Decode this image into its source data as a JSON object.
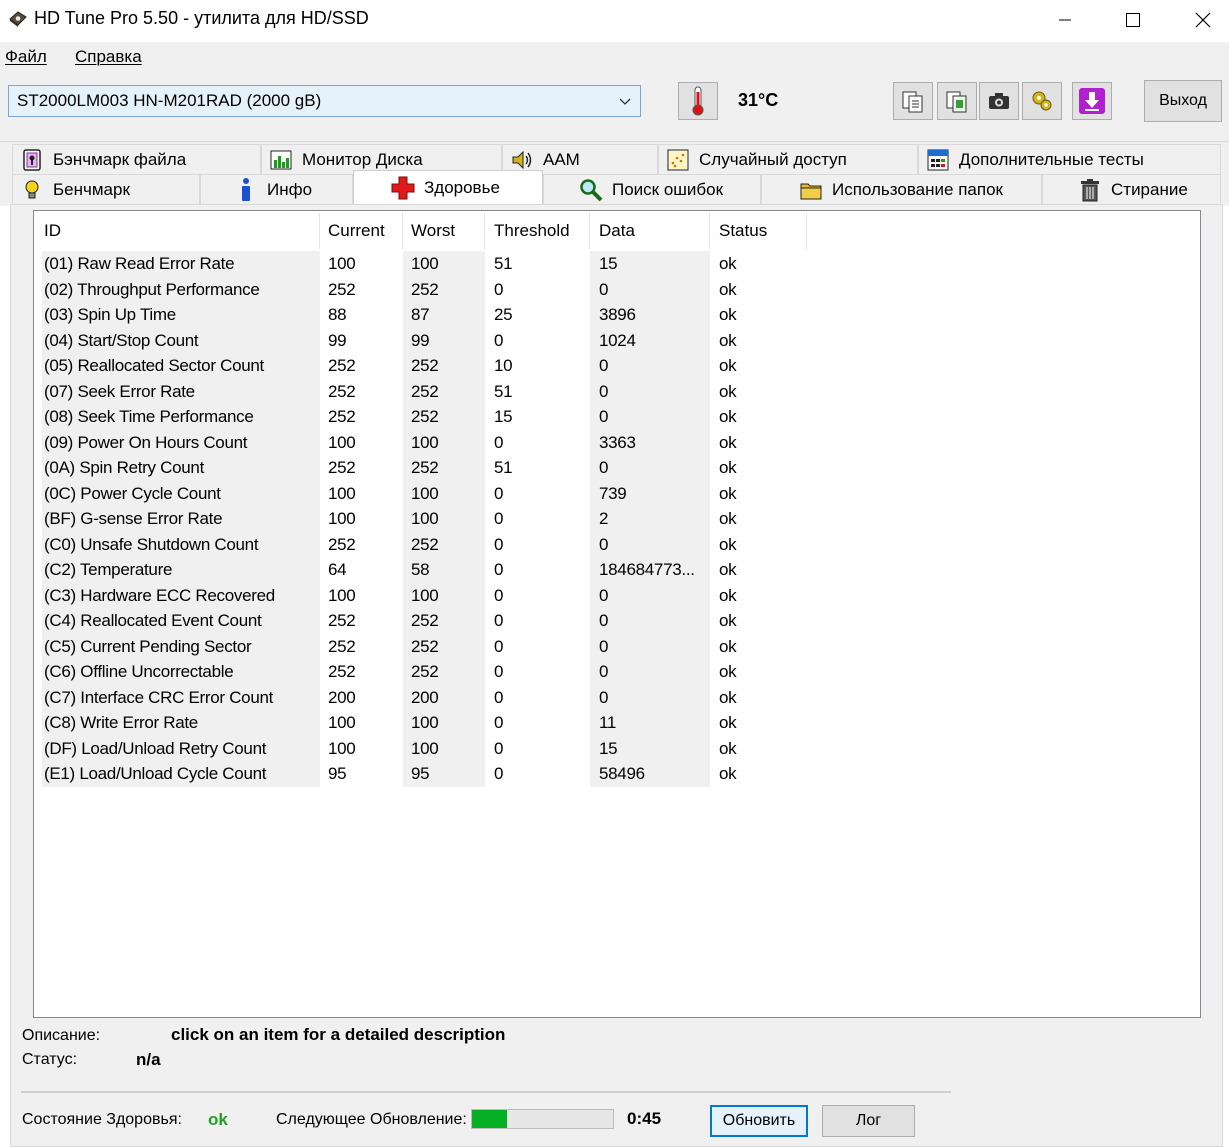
{
  "window": {
    "title": "HD Tune Pro 5.50 - утилита для HD/SSD"
  },
  "menu": {
    "file": "Файл",
    "help": "Справка"
  },
  "toolbar": {
    "drive": "ST2000LM003 HN-M201RAD (2000 gB)",
    "temperature": "31°C",
    "exit_label": "Выход"
  },
  "tabs": {
    "top": [
      "Бэнчмарк файла",
      "Монитор Диска",
      "AAM",
      "Случайный доступ",
      "Дополнительные  тесты"
    ],
    "bottom": [
      "Бенчмарк",
      "Инфо",
      "Здоровье",
      "Поиск ошибок",
      "Использование папок",
      "Стирание"
    ],
    "active": "Здоровье"
  },
  "smart": {
    "headers": [
      "ID",
      "Current",
      "Worst",
      "Threshold",
      "Data",
      "Status"
    ],
    "rows": [
      [
        "(01) Raw Read Error Rate",
        "100",
        "100",
        "51",
        "15",
        "ok"
      ],
      [
        "(02) Throughput Performance",
        "252",
        "252",
        "0",
        "0",
        "ok"
      ],
      [
        "(03) Spin Up Time",
        "88",
        "87",
        "25",
        "3896",
        "ok"
      ],
      [
        "(04) Start/Stop Count",
        "99",
        "99",
        "0",
        "1024",
        "ok"
      ],
      [
        "(05) Reallocated Sector Count",
        "252",
        "252",
        "10",
        "0",
        "ok"
      ],
      [
        "(07) Seek Error Rate",
        "252",
        "252",
        "51",
        "0",
        "ok"
      ],
      [
        "(08) Seek Time Performance",
        "252",
        "252",
        "15",
        "0",
        "ok"
      ],
      [
        "(09) Power On Hours Count",
        "100",
        "100",
        "0",
        "3363",
        "ok"
      ],
      [
        "(0A) Spin Retry Count",
        "252",
        "252",
        "51",
        "0",
        "ok"
      ],
      [
        "(0C) Power Cycle Count",
        "100",
        "100",
        "0",
        "739",
        "ok"
      ],
      [
        "(BF) G-sense Error Rate",
        "100",
        "100",
        "0",
        "2",
        "ok"
      ],
      [
        "(C0) Unsafe Shutdown Count",
        "252",
        "252",
        "0",
        "0",
        "ok"
      ],
      [
        "(C2) Temperature",
        "64",
        "58",
        "0",
        "184684773...",
        "ok"
      ],
      [
        "(C3) Hardware ECC Recovered",
        "100",
        "100",
        "0",
        "0",
        "ok"
      ],
      [
        "(C4) Reallocated Event Count",
        "252",
        "252",
        "0",
        "0",
        "ok"
      ],
      [
        "(C5) Current Pending Sector",
        "252",
        "252",
        "0",
        "0",
        "ok"
      ],
      [
        "(C6) Offline Uncorrectable",
        "252",
        "252",
        "0",
        "0",
        "ok"
      ],
      [
        "(C7) Interface CRC Error Count",
        "200",
        "200",
        "0",
        "0",
        "ok"
      ],
      [
        "(C8) Write Error Rate",
        "100",
        "100",
        "0",
        "11",
        "ok"
      ],
      [
        "(DF) Load/Unload Retry Count",
        "100",
        "100",
        "0",
        "15",
        "ok"
      ],
      [
        "(E1) Load/Unload Cycle Count",
        "95",
        "95",
        "0",
        "58496",
        "ok"
      ]
    ]
  },
  "details": {
    "description_label": "Описание:",
    "description_value": "click on an item for a detailed description",
    "status_label": "Статус:",
    "status_value": "n/a"
  },
  "footer": {
    "health_label": "Состояние Здоровья:",
    "health_value": "ok",
    "next_update_label": "Следующее Обновление:",
    "progress_fraction": 0.25,
    "timer": "0:45",
    "refresh_label": "Обновить",
    "log_label": "Лог"
  },
  "colors": {
    "health_ok": "#1fa21f",
    "progress": "#06b025",
    "accent": "#0078d7"
  }
}
